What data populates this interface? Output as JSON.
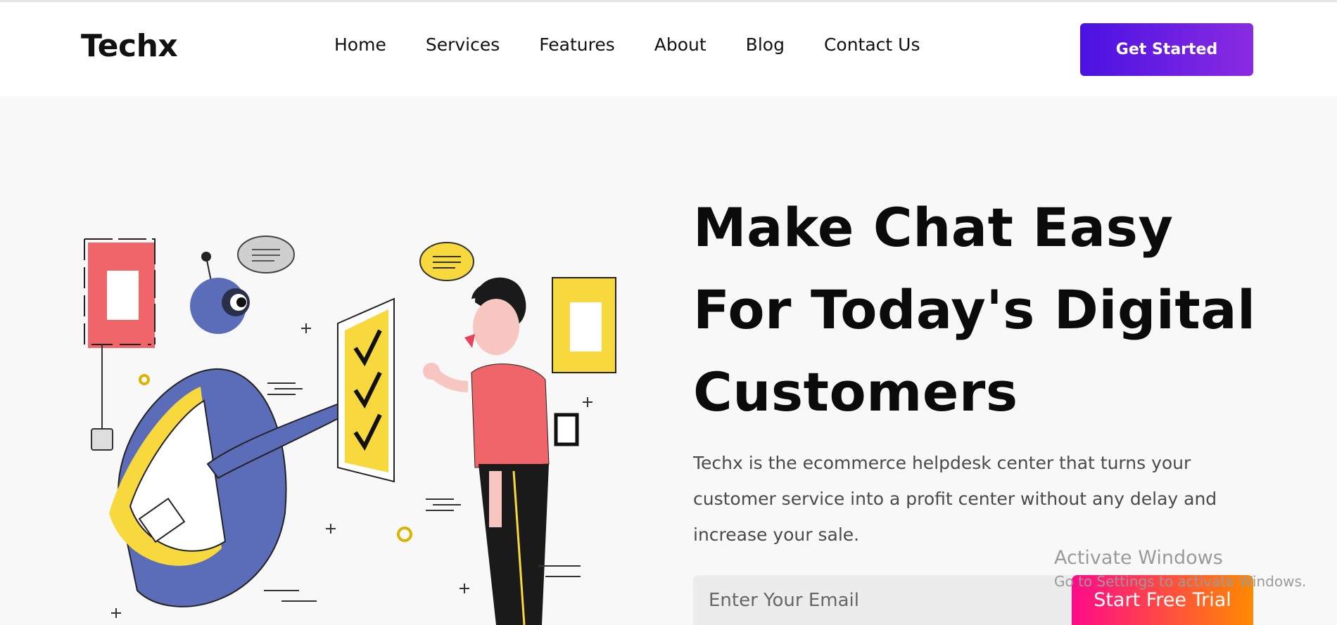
{
  "brand": {
    "logo": "Techx"
  },
  "nav": {
    "items": [
      {
        "label": "Home"
      },
      {
        "label": "Services"
      },
      {
        "label": "Features"
      },
      {
        "label": "About"
      },
      {
        "label": "Blog"
      },
      {
        "label": "Contact Us"
      }
    ],
    "cta_label": "Get Started"
  },
  "hero": {
    "title_lines": [
      "Make Chat Easy",
      "For Today's Digital",
      "Customers"
    ],
    "description": "Techx is the ecommerce helpdesk center that turns your customer service into a profit center without any delay and increase your sale.",
    "email_placeholder": "Enter Your Email",
    "trial_label": "Start Free Trial"
  },
  "watermark": {
    "title": "Activate Windows",
    "subtitle": "Go to Settings to activate Windows."
  },
  "colors": {
    "primary_gradient_start": "#4a12e2",
    "primary_gradient_end": "#8a2be2",
    "cta_gradient_start": "#ff0a8a",
    "cta_gradient_end": "#ff8a00",
    "robot_blue": "#5b6db8",
    "accent_yellow": "#f7d83d",
    "accent_red": "#f0656a"
  }
}
